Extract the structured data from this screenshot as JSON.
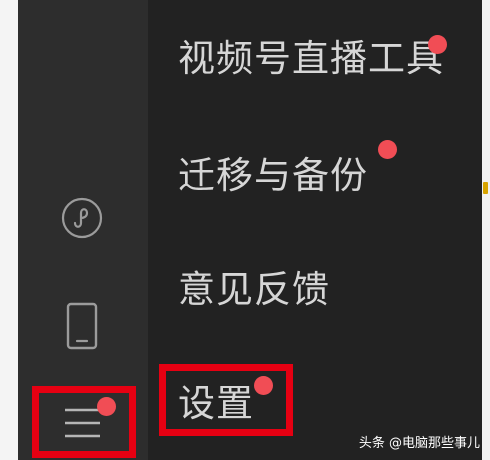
{
  "menu": {
    "items": [
      {
        "label": "视频号直播工具",
        "has_dot": true
      },
      {
        "label": "迁移与备份",
        "has_dot": true
      },
      {
        "label": "意见反馈",
        "has_dot": false
      },
      {
        "label": "设置",
        "has_dot": true
      }
    ]
  },
  "sidebar": {
    "icons": [
      "mini-program-icon",
      "phone-icon",
      "menu-icon"
    ]
  },
  "watermark": {
    "text": "头条 @电脑那些事儿"
  },
  "colors": {
    "menu_background": "#222222",
    "sidebar_background": "#2d2d2d",
    "notification_dot": "#f14d55",
    "highlight_box": "#e60012",
    "menu_text": "#d6d6d6"
  }
}
